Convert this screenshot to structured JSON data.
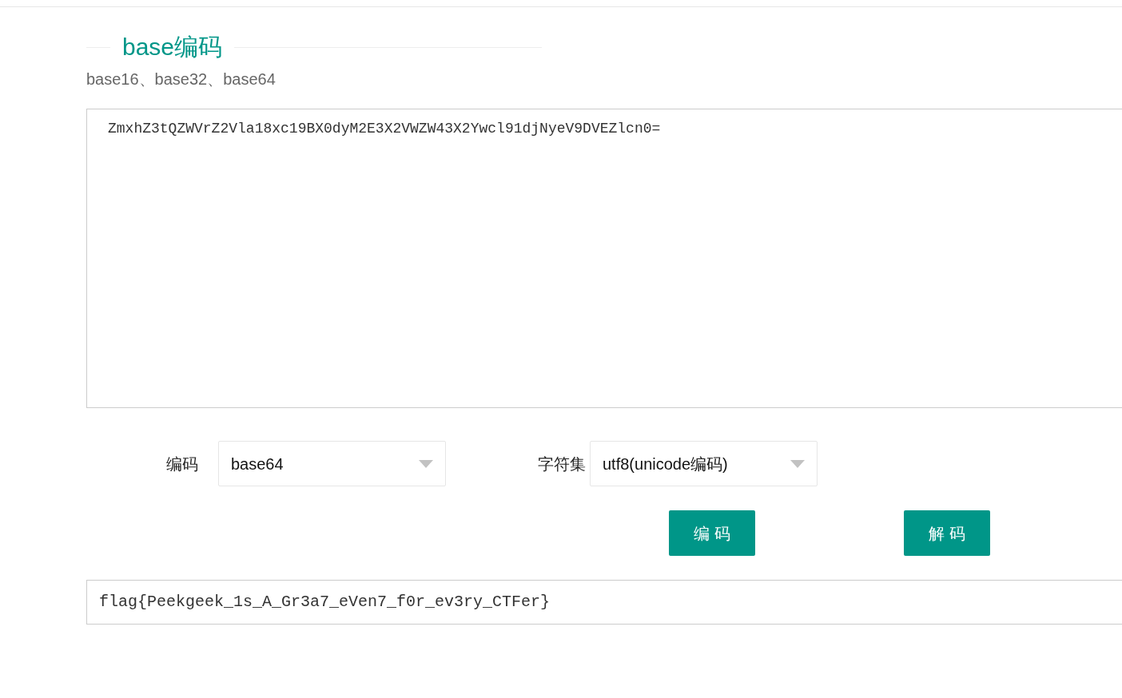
{
  "title": "base编码",
  "subtitle": "base16、base32、base64",
  "input": {
    "value": "ZmxhZ3tQZWVrZ2Vla18xc19BX0dyM2E3X2VWZW43X2Ywcl91djNyeV9DVEZlcn0="
  },
  "selects": [
    {
      "label": "编码",
      "value": "base64"
    },
    {
      "label": "字符集",
      "value": "utf8(unicode编码)"
    }
  ],
  "buttons": [
    "编 码",
    "解 码"
  ],
  "output": {
    "value": "flag{Peekgeek_1s_A_Gr3a7_eVen7_f0r_ev3ry_CTFer}"
  }
}
